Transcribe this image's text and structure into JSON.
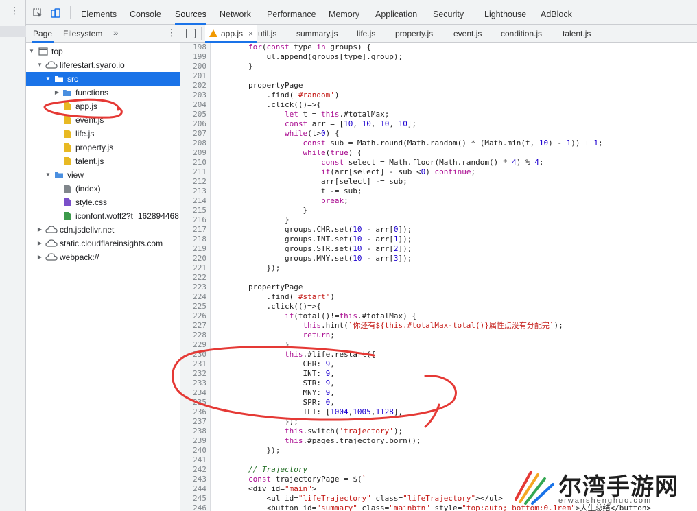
{
  "toolbar": {
    "tabs": [
      "Elements",
      "Console",
      "Sources",
      "Network",
      "Performance",
      "Memory",
      "Application",
      "Security",
      "Lighthouse",
      "AdBlock"
    ],
    "active_tab": "Sources"
  },
  "navigator": {
    "tabs": [
      "Page",
      "Filesystem"
    ],
    "more": "»",
    "tree": [
      {
        "label": "top"
      },
      {
        "label": "liferestart.syaro.io"
      },
      {
        "label": "src"
      },
      {
        "label": "functions"
      },
      {
        "label": "app.js"
      },
      {
        "label": "event.js"
      },
      {
        "label": "life.js"
      },
      {
        "label": "property.js"
      },
      {
        "label": "talent.js"
      },
      {
        "label": "view"
      },
      {
        "label": "(index)"
      },
      {
        "label": "style.css"
      },
      {
        "label": "iconfont.woff2?t=162894468"
      },
      {
        "label": "cdn.jsdelivr.net"
      },
      {
        "label": "static.cloudflareinsights.com"
      },
      {
        "label": "webpack://"
      }
    ]
  },
  "editor": {
    "tabs": [
      "app.js",
      "util.js",
      "summary.js",
      "life.js",
      "property.js",
      "event.js",
      "condition.js",
      "talent.js"
    ],
    "active_tab": "app.js",
    "lines": [
      {
        "n": "198",
        "t": "        for(const type in groups) {"
      },
      {
        "n": "199",
        "t": "            ul.append(groups[type].group);"
      },
      {
        "n": "200",
        "t": "        }"
      },
      {
        "n": "201",
        "t": ""
      },
      {
        "n": "202",
        "t": "        propertyPage"
      },
      {
        "n": "203",
        "t": "            .find('#random')"
      },
      {
        "n": "204",
        "t": "            .click(()=>{"
      },
      {
        "n": "205",
        "t": "                let t = this.#totalMax;"
      },
      {
        "n": "206",
        "t": "                const arr = [10, 10, 10, 10];"
      },
      {
        "n": "207",
        "t": "                while(t>0) {"
      },
      {
        "n": "208",
        "t": "                    const sub = Math.round(Math.random() * (Math.min(t, 10) - 1)) + 1;"
      },
      {
        "n": "209",
        "t": "                    while(true) {"
      },
      {
        "n": "210",
        "t": "                        const select = Math.floor(Math.random() * 4) % 4;"
      },
      {
        "n": "211",
        "t": "                        if(arr[select] - sub <0) continue;"
      },
      {
        "n": "212",
        "t": "                        arr[select] -= sub;"
      },
      {
        "n": "213",
        "t": "                        t -= sub;"
      },
      {
        "n": "214",
        "t": "                        break;"
      },
      {
        "n": "215",
        "t": "                    }"
      },
      {
        "n": "216",
        "t": "                }"
      },
      {
        "n": "217",
        "t": "                groups.CHR.set(10 - arr[0]);"
      },
      {
        "n": "218",
        "t": "                groups.INT.set(10 - arr[1]);"
      },
      {
        "n": "219",
        "t": "                groups.STR.set(10 - arr[2]);"
      },
      {
        "n": "220",
        "t": "                groups.MNY.set(10 - arr[3]);"
      },
      {
        "n": "221",
        "t": "            });"
      },
      {
        "n": "222",
        "t": ""
      },
      {
        "n": "223",
        "t": "        propertyPage"
      },
      {
        "n": "224",
        "t": "            .find('#start')"
      },
      {
        "n": "225",
        "t": "            .click(()=>{"
      },
      {
        "n": "226",
        "t": "                if(total()!=this.#totalMax) {"
      },
      {
        "n": "227",
        "t": "                    this.hint(`你还有${this.#totalMax-total()}属性点没有分配完`);"
      },
      {
        "n": "228",
        "t": "                    return;"
      },
      {
        "n": "229",
        "t": "                }"
      },
      {
        "n": "230",
        "t": "                this.#life.restart({"
      },
      {
        "n": "231",
        "t": "                    CHR: 9,"
      },
      {
        "n": "232",
        "t": "                    INT: 9,"
      },
      {
        "n": "233",
        "t": "                    STR: 9,"
      },
      {
        "n": "234",
        "t": "                    MNY: 9,"
      },
      {
        "n": "235",
        "t": "                    SPR: 0,"
      },
      {
        "n": "236",
        "t": "                    TLT: [1004,1005,1128],"
      },
      {
        "n": "237",
        "t": "                });"
      },
      {
        "n": "238",
        "t": "                this.switch('trajectory');"
      },
      {
        "n": "239",
        "t": "                this.#pages.trajectory.born();"
      },
      {
        "n": "240",
        "t": "            });"
      },
      {
        "n": "241",
        "t": ""
      },
      {
        "n": "242",
        "t": "        // Trajectory"
      },
      {
        "n": "243",
        "t": "        const trajectoryPage = $(`"
      },
      {
        "n": "244",
        "t": "        <div id=\"main\">"
      },
      {
        "n": "245",
        "t": "            <ul id=\"lifeTrajectory\" class=\"lifeTrajectory\"></ul>"
      },
      {
        "n": "246",
        "t": "            <button id=\"summary\" class=\"mainbtn\" style=\"top:auto; bottom:0.1rem\">人生总结</button>"
      }
    ]
  },
  "watermark": {
    "title": "尔湾手游网",
    "subtitle": "erwanshenghuo.com"
  },
  "colors": {
    "accent": "#1a73e8",
    "annotation": "#e53935",
    "folder": "#4a8fe0",
    "js_file": "#e8b923"
  }
}
